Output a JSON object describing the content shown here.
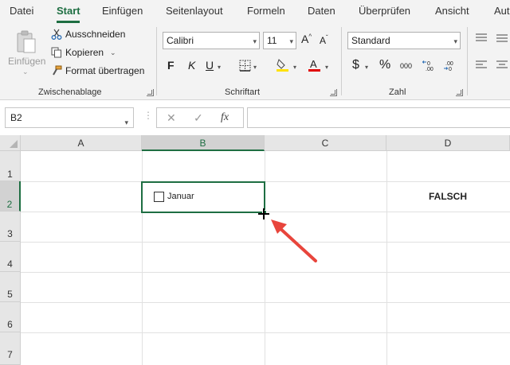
{
  "menu": {
    "tabs": [
      "Datei",
      "Start",
      "Einfügen",
      "Seitenlayout",
      "Formeln",
      "Daten",
      "Überprüfen",
      "Ansicht",
      "Aut"
    ],
    "active": "Start"
  },
  "ribbon": {
    "clipboard": {
      "paste_label": "Einfügen",
      "cut_label": "Ausschneiden",
      "copy_label": "Kopieren",
      "format_painter_label": "Format übertragen",
      "group_label": "Zwischenablage"
    },
    "font": {
      "font_name": "Calibri",
      "font_size": "11",
      "bold": "F",
      "italic": "K",
      "underline": "U",
      "group_label": "Schriftart"
    },
    "number": {
      "format": "Standard",
      "currency": "$",
      "percent": "%",
      "thousands": "000",
      "group_label": "Zahl"
    }
  },
  "formula_bar": {
    "name_box": "B2",
    "fx": "fx",
    "formula": ""
  },
  "grid": {
    "columns": [
      "A",
      "B",
      "C",
      "D"
    ],
    "selected_column": "B",
    "rows": [
      "1",
      "2",
      "3",
      "4",
      "5",
      "6",
      "7"
    ],
    "selected_row": "2",
    "cells": {
      "B2_checkbox_label": "Januar",
      "D2": "FALSCH"
    }
  },
  "colors": {
    "accent": "#1e6e42",
    "arrow": "#e8453c"
  }
}
